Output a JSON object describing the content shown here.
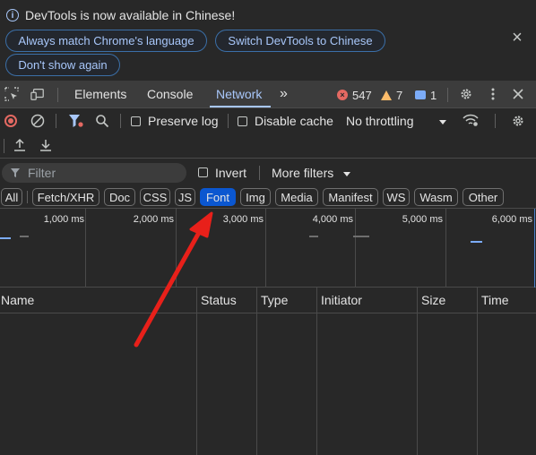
{
  "banner": {
    "message": "DevTools is now available in Chinese!",
    "buttons": [
      "Always match Chrome's language",
      "Switch DevTools to Chinese",
      "Don't show again"
    ]
  },
  "tabs": {
    "items": [
      "Elements",
      "Console",
      "Network"
    ],
    "active": "Network",
    "errors": "547",
    "warnings": "7",
    "messages": "1"
  },
  "toolbar": {
    "preserve_log": "Preserve log",
    "disable_cache": "Disable cache",
    "throttling": "No throttling"
  },
  "filter": {
    "placeholder": "Filter",
    "invert": "Invert",
    "more_filters": "More filters"
  },
  "type_filters": {
    "items": [
      "All",
      "Fetch/XHR",
      "Doc",
      "CSS",
      "JS",
      "Font",
      "Img",
      "Media",
      "Manifest",
      "WS",
      "Wasm",
      "Other"
    ],
    "active": "Font"
  },
  "overview": {
    "ticks": [
      "1,000 ms",
      "2,000 ms",
      "3,000 ms",
      "4,000 ms",
      "5,000 ms",
      "6,000 ms"
    ]
  },
  "table": {
    "columns": [
      "Name",
      "Status",
      "Type",
      "Initiator",
      "Size",
      "Time"
    ]
  },
  "colors": {
    "accent": "#a8c7fa",
    "active_chip": "#0b57d0",
    "annotation_arrow": "#e8201a",
    "error": "#e46962",
    "warning": "#fdbc6a"
  }
}
